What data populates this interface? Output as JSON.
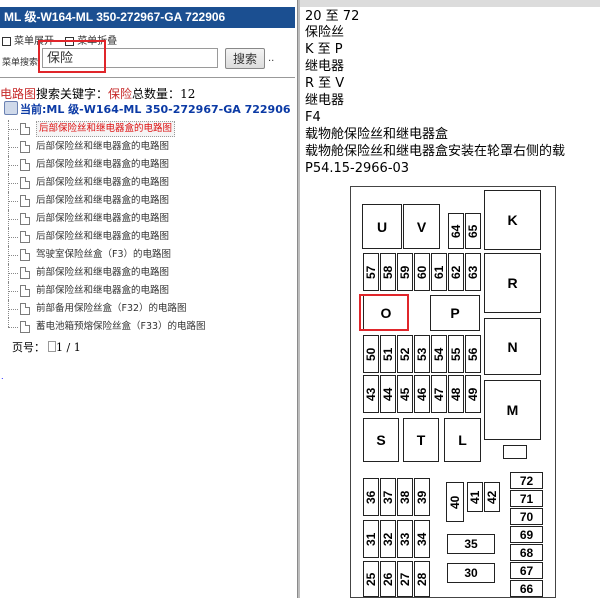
{
  "window": {
    "title": "ML 级-W164-ML 350-272967-GA 722906"
  },
  "menu": {
    "expand_label": "菜单展开",
    "collapse_label": "菜单折叠"
  },
  "search": {
    "label": "菜单搜索",
    "value": "保险",
    "button_label": "搜索",
    "extra": ".."
  },
  "result": {
    "prefix": "电路图",
    "middle": "搜索关键字：",
    "keyword": "保险",
    "count_label": "总数量：",
    "count": "12"
  },
  "current": {
    "label": "当前:ML 级-W164-ML 350-272967-GA 722906"
  },
  "tree": {
    "items": [
      {
        "label": "后部保险丝和继电器盒的电路图",
        "selected": true
      },
      {
        "label": "后部保险丝和继电器盒的电路图"
      },
      {
        "label": "后部保险丝和继电器盒的电路图"
      },
      {
        "label": "后部保险丝和继电器盒的电路图"
      },
      {
        "label": "后部保险丝和继电器盒的电路图"
      },
      {
        "label": "后部保险丝和继电器盒的电路图"
      },
      {
        "label": "后部保险丝和继电器盒的电路图"
      },
      {
        "label": "驾驶室保险丝盒（F3）的电路图"
      },
      {
        "label": "前部保险丝和继电器盒的电路图"
      },
      {
        "label": "前部保险丝和继电器盒的电路图"
      },
      {
        "label": "前部备用保险丝盒（F32）的电路图"
      },
      {
        "label": "蓄电池箱预熔保险丝盒（F33）的电路图"
      }
    ]
  },
  "paging": {
    "label": "页号：",
    "value": "1 / 1"
  },
  "detail": {
    "lines": [
      "20 至 72",
      "保险丝",
      "K 至 P",
      "继电器",
      "R 至 V",
      "继电器",
      "F4",
      "载物舱保险丝和继电器盒",
      "载物舱保险丝和继电器盒安装在轮罩右侧的载",
      "P54.15-2966-03"
    ]
  },
  "diagram": {
    "relays": [
      "K",
      "R",
      "N",
      "M",
      "U",
      "V",
      "O",
      "P",
      "S",
      "T",
      "L"
    ],
    "fuses_top_small": [
      "64",
      "65"
    ],
    "fuses_row1": [
      "57",
      "58",
      "59",
      "60",
      "61",
      "62",
      "63"
    ],
    "fuses_row2": [
      "50",
      "51",
      "52",
      "53",
      "54",
      "55",
      "56"
    ],
    "fuses_row3": [
      "43",
      "44",
      "45",
      "46",
      "47",
      "48",
      "49"
    ],
    "fuses_row4": [
      "36",
      "37",
      "38",
      "39",
      "40",
      "41",
      "42"
    ],
    "fuses_row5": [
      "31",
      "32",
      "33",
      "34"
    ],
    "fuses_row6": [
      "25",
      "26",
      "27",
      "28"
    ],
    "fuses_mid": [
      "35",
      "30"
    ],
    "fuses_right_col": [
      "72",
      "71",
      "70",
      "69",
      "68",
      "67",
      "66"
    ],
    "highlight_color": "#e0262b"
  }
}
